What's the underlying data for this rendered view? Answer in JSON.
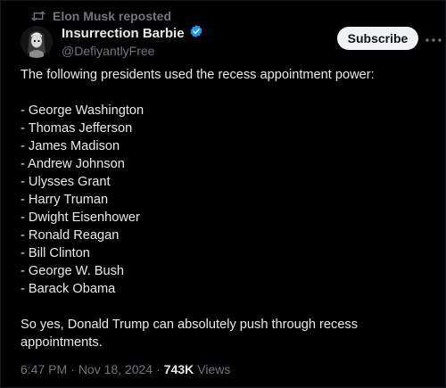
{
  "repost": {
    "icon": "repost-icon",
    "label": "Elon Musk reposted"
  },
  "author": {
    "display_name": "Insurrection Barbie",
    "handle": "@DefiyantlyFree",
    "verified_icon": "verified-badge-icon",
    "verified_color": "#1d9bf0"
  },
  "actions": {
    "subscribe_label": "Subscribe",
    "more_icon": "more-options-icon"
  },
  "tweet": {
    "intro": "The following presidents used the recess appointment power:",
    "presidents": [
      "- George Washington",
      "- Thomas Jefferson",
      "- James Madison",
      "- Andrew Johnson",
      "- Ulysses Grant",
      "- Harry Truman",
      "- Dwight Eisenhower",
      "- Ronald Reagan",
      "- Bill Clinton",
      "- George W. Bush",
      "- Barack Obama"
    ],
    "outro": "So yes, Donald Trump can absolutely push through recess appointments."
  },
  "meta": {
    "time": "6:47 PM",
    "separator": "·",
    "date": "Nov 18, 2024",
    "views_count": "743K",
    "views_label": "Views"
  },
  "colors": {
    "background": "#000000",
    "text_primary": "#e7e9ea",
    "text_secondary": "#71767b",
    "button_bg": "#eff3f4"
  }
}
